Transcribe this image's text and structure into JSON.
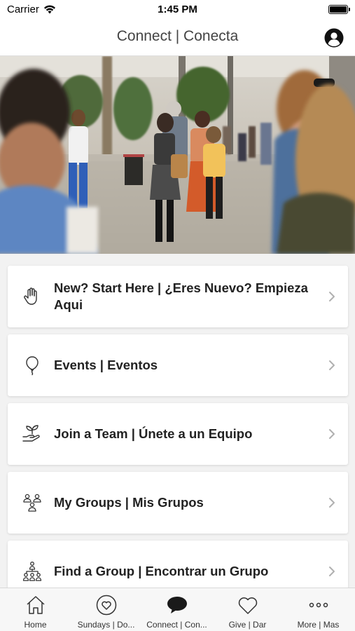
{
  "status_bar": {
    "carrier": "Carrier",
    "time": "1:45 PM"
  },
  "nav": {
    "title": "Connect | Conecta"
  },
  "hero": {
    "icon": "hero-photo"
  },
  "cards": [
    {
      "label": "New? Start Here | ¿Eres Nuevo? Empieza Aqui",
      "icon": "hand-wave-icon"
    },
    {
      "label": "Events | Eventos",
      "icon": "balloon-icon"
    },
    {
      "label": "Join a Team | Únete a un Equipo",
      "icon": "hand-plant-icon"
    },
    {
      "label": "My Groups | Mis Grupos",
      "icon": "group-icon"
    },
    {
      "label": "Find a Group | Encontrar un Grupo",
      "icon": "people-network-icon"
    }
  ],
  "tabs": [
    {
      "label": "Home",
      "icon": "home-icon"
    },
    {
      "label": "Sundays | Do...",
      "icon": "heart-circle-icon"
    },
    {
      "label": "Connect | Con...",
      "icon": "chat-bubble-icon",
      "active": true
    },
    {
      "label": "Give | Dar",
      "icon": "heart-icon"
    },
    {
      "label": "More | Mas",
      "icon": "more-dots-icon"
    }
  ],
  "colors": {
    "background": "#f2f2f2",
    "card": "#ffffff",
    "text": "#222222",
    "chevron": "#b0b0b0"
  }
}
